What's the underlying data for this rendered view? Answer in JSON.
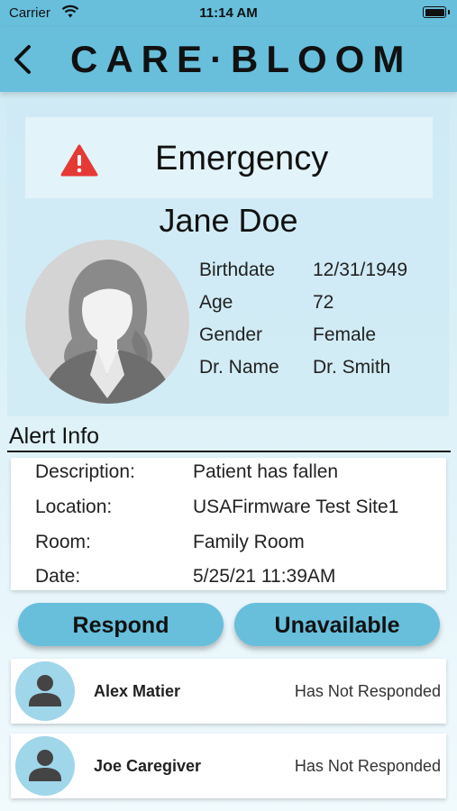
{
  "status_bar": {
    "carrier": "Carrier",
    "time": "11:14 AM"
  },
  "header": {
    "back_icon": "chevron-left-icon",
    "brand": "CARE·BLOOM"
  },
  "emergency": {
    "icon": "warning-triangle-icon",
    "label": "Emergency",
    "icon_color": "#e53935"
  },
  "patient": {
    "name": "Jane Doe",
    "photo_icon": "patient-avatar-icon",
    "fields": [
      {
        "label": "Birthdate",
        "value": "12/31/1949"
      },
      {
        "label": "Age",
        "value": "72"
      },
      {
        "label": "Gender",
        "value": "Female"
      },
      {
        "label": "Dr. Name",
        "value": "Dr. Smith"
      }
    ]
  },
  "alert_info": {
    "title": "Alert Info",
    "rows": [
      {
        "label": "Description:",
        "value": "Patient has fallen"
      },
      {
        "label": "Location:",
        "value": "USAFirmware Test Site1"
      },
      {
        "label": "Room:",
        "value": "Family Room"
      },
      {
        "label": "Date:",
        "value": "5/25/21 11:39AM"
      }
    ]
  },
  "actions": {
    "respond": "Respond",
    "unavailable": "Unavailable"
  },
  "caregivers": [
    {
      "name": "Alex Matier",
      "status": "Has Not Responded",
      "icon": "person-icon"
    },
    {
      "name": "Joe Caregiver",
      "status": "Has Not Responded",
      "icon": "person-icon"
    }
  ],
  "colors": {
    "accent": "#67bfdc",
    "warning": "#e53935",
    "avatar_bg": "#9fd6ea"
  }
}
